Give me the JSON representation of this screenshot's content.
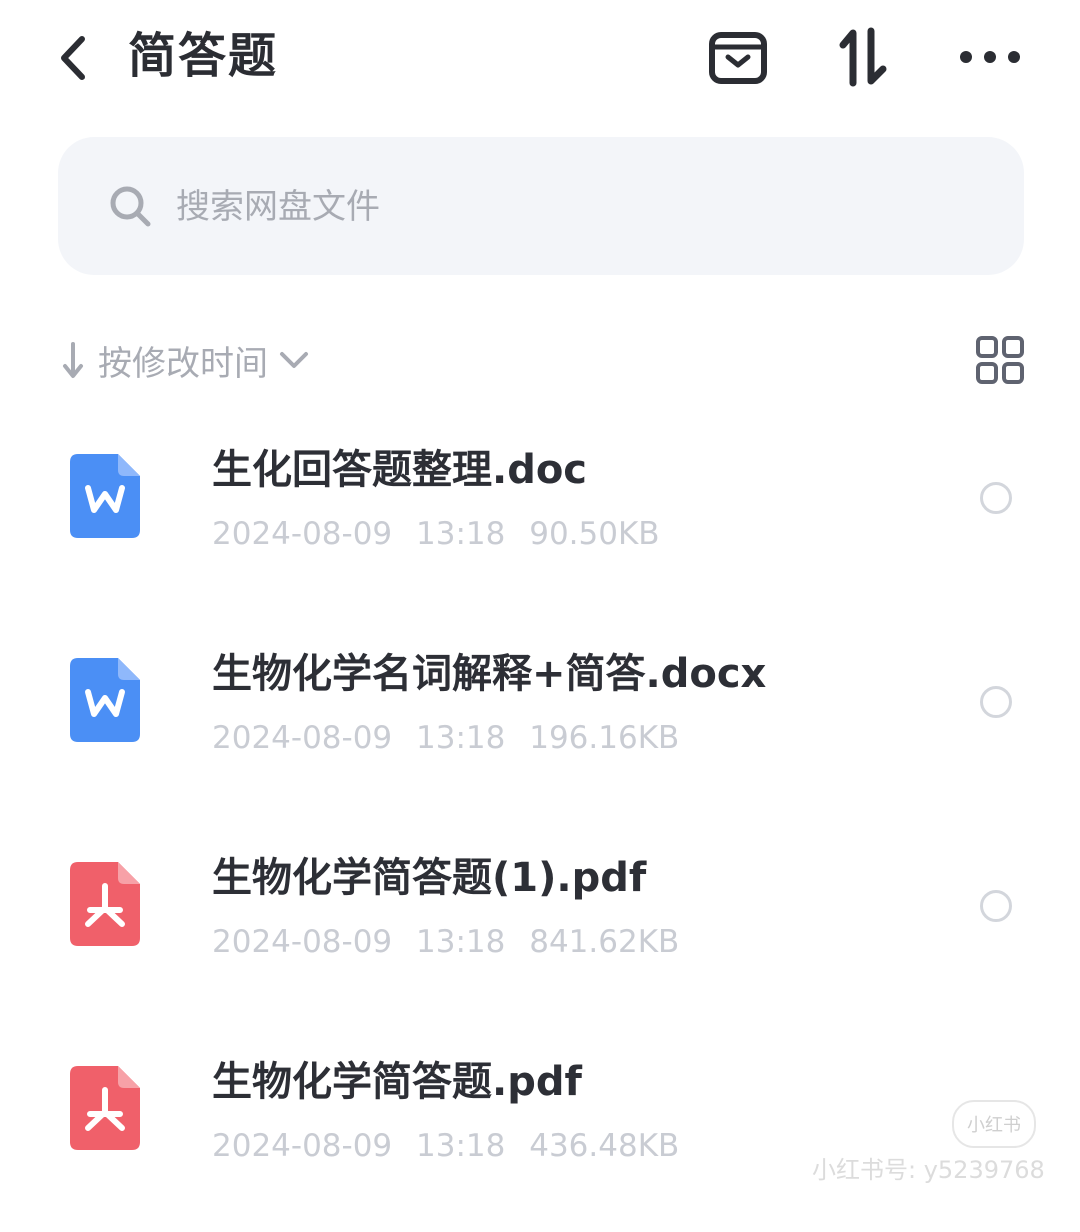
{
  "header": {
    "title": "简答题",
    "back_icon": "chevron-left-icon",
    "actions": [
      "archive-icon",
      "transfer-icon",
      "more-icon"
    ]
  },
  "search": {
    "placeholder": "搜索网盘文件"
  },
  "sort": {
    "label": "按修改时间"
  },
  "files": [
    {
      "name": "生化回答题整理.doc",
      "date": "2024-08-09",
      "time": "13:18",
      "size": "90.50KB",
      "type": "word"
    },
    {
      "name": "生物化学名词解释+简答.docx",
      "date": "2024-08-09",
      "time": "13:18",
      "size": "196.16KB",
      "type": "word"
    },
    {
      "name": "生物化学简答题(1).pdf",
      "date": "2024-08-09",
      "time": "13:18",
      "size": "841.62KB",
      "type": "pdf"
    },
    {
      "name": "生物化学简答题.pdf",
      "date": "2024-08-09",
      "time": "13:18",
      "size": "436.48KB",
      "type": "pdf"
    }
  ],
  "watermark": {
    "logo": "小红书",
    "id_text": "小红书号: y5239768"
  },
  "colors": {
    "word": "#4b8ff5",
    "pdf": "#f0606a",
    "search_bg": "#f3f5f9"
  }
}
